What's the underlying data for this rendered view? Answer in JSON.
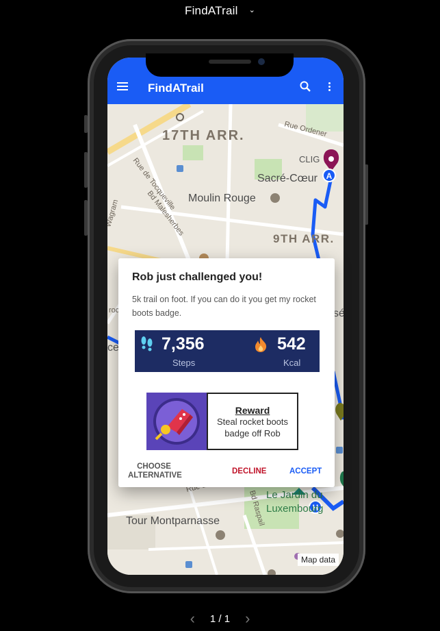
{
  "viewer": {
    "title": "FindATrail",
    "chevron": "⌄",
    "page": "1 / 1",
    "prev": "‹",
    "next": "›"
  },
  "app": {
    "title": "FindATrail"
  },
  "map": {
    "labels": {
      "arr17": "17TH ARR.",
      "arr9": "9TH ARR.",
      "clignancourt": "CLIG",
      "sacre_coeur": "Sacré-Cœur",
      "moulin_rouge": "Moulin Rouge",
      "rue_ordener": "Rue Ordener",
      "rue_tocqueville": "Rue de Tocqueville",
      "bd_malesherbes": "Bd Malesherbes",
      "wagram": "Wagram",
      "jardin": "Le Jardin du",
      "luxembourg": "Luxembourg",
      "bd_raspail": "Bd Raspail",
      "rue": "Rue d",
      "tour": "Tour Montparnasse",
      "roche": "roche",
      "ce": "ce",
      "se": "sé"
    },
    "pin_a": "A",
    "pin_h": "H",
    "attribution": "Map data"
  },
  "dialog": {
    "title": "Rob just challenged you!",
    "body": "5k trail on foot. If you can do it you get my rocket boots badge.",
    "steps_value": "7,356",
    "steps_unit": "Steps",
    "kcal_value": "542",
    "kcal_unit": "Kcal",
    "reward_title": "Reward",
    "reward_line1": "Steal rocket boots",
    "reward_line2": "badge off Rob",
    "choose_line1": "CHOOSE",
    "choose_line2": "ALTERNATIVE",
    "decline": "DECLINE",
    "accept": "ACCEPT"
  },
  "colors": {
    "appbar": "#1a5cf5",
    "stats_bg": "#1d2c63",
    "decline": "#c0142a",
    "accept": "#1a5cf5",
    "route": "#1a5cf5",
    "reward_art": "#5a44b8"
  }
}
